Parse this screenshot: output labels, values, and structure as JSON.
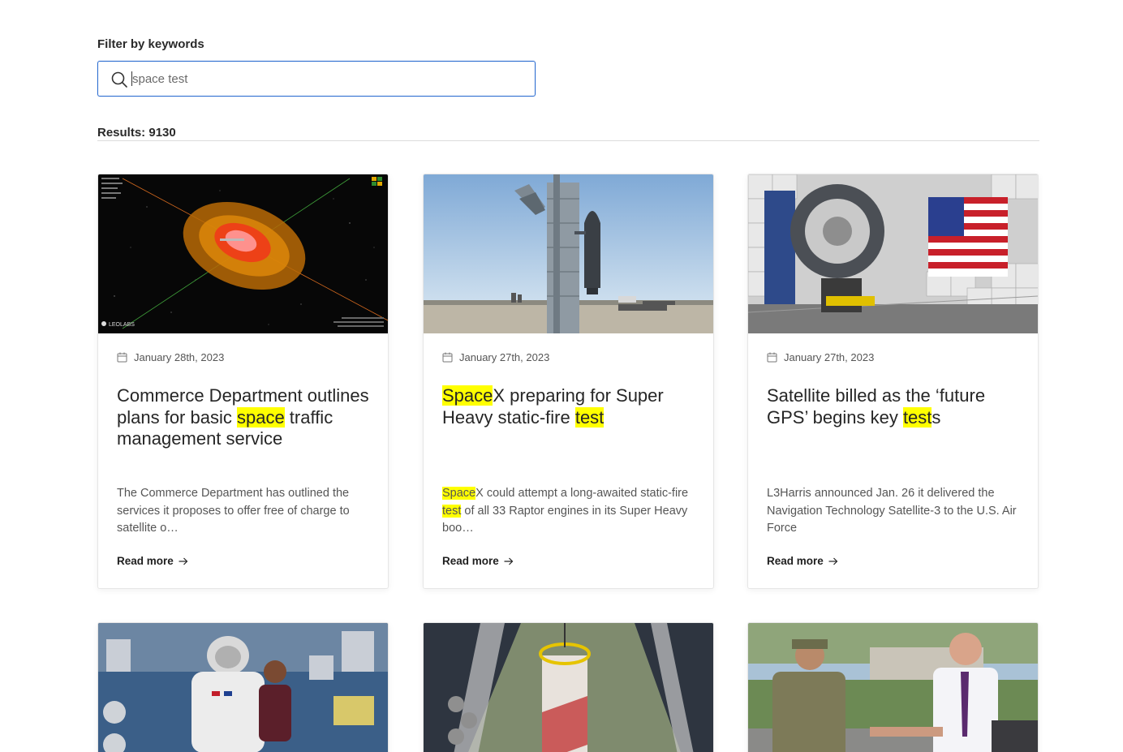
{
  "filter": {
    "label": "Filter by keywords",
    "query": "space test"
  },
  "results": {
    "text": "Results: 9130"
  },
  "read_more_label": "Read more",
  "cards": [
    {
      "date": "January 28th, 2023",
      "title_parts": [
        "Commerce Department outlines plans for basic ",
        "space",
        " traffic management service"
      ],
      "excerpt_parts": [
        "The Commerce Department has outlined the services it proposes to offer free of charge to satellite o…"
      ],
      "image": "orbit-visualization-image",
      "image_caption": "LEOLABS"
    },
    {
      "date": "January 27th, 2023",
      "title_parts": [
        "Space",
        "X preparing for Super Heavy static-fire ",
        "test"
      ],
      "excerpt_parts": [
        "Space",
        "X could attempt a long-awaited static-fire ",
        "test",
        " of all 33 Raptor engines in its Super Heavy boo…"
      ],
      "image": "starship-launch-tower-image"
    },
    {
      "date": "January 27th, 2023",
      "title_parts": [
        "Satellite billed as the ‘future GPS’ begins key ",
        "test",
        "s"
      ],
      "excerpt_parts": [
        "L3Harris announced Jan. 26 it delivered the Navigation Technology Satellite-3 to the U.S. Air Force"
      ],
      "image": "satellite-anechoic-chamber-image"
    },
    {
      "image": "astronaut-iss-image"
    },
    {
      "image": "rocket-stack-aerial-image"
    },
    {
      "image": "handshake-military-image"
    }
  ],
  "colors": {
    "highlight": "#ffff00",
    "search_border": "#2f6fd1"
  }
}
